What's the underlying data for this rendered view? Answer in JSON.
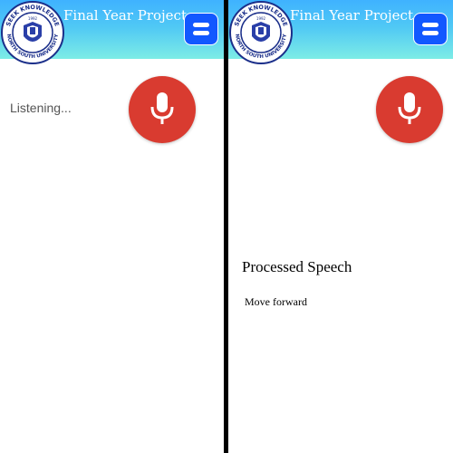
{
  "app": {
    "title": "Final Year Project"
  },
  "logo": {
    "text_top": "SEEK KNOWLEDGE",
    "text_bottom": "NORTH SOUTH UNIVERSITY",
    "year": "1992"
  },
  "icons": {
    "menu": "menu-icon",
    "mic": "microphone-icon",
    "logo": "university-logo"
  },
  "colors": {
    "header_top": "#3fb2ff",
    "header_bottom": "#7dece6",
    "menu_button": "#1258ff",
    "mic_button": "#d93b30",
    "divider": "#000000"
  },
  "left_screen": {
    "status": "Listening..."
  },
  "right_screen": {
    "processed_title": "Processed Speech",
    "processed_text": "Move forward"
  }
}
